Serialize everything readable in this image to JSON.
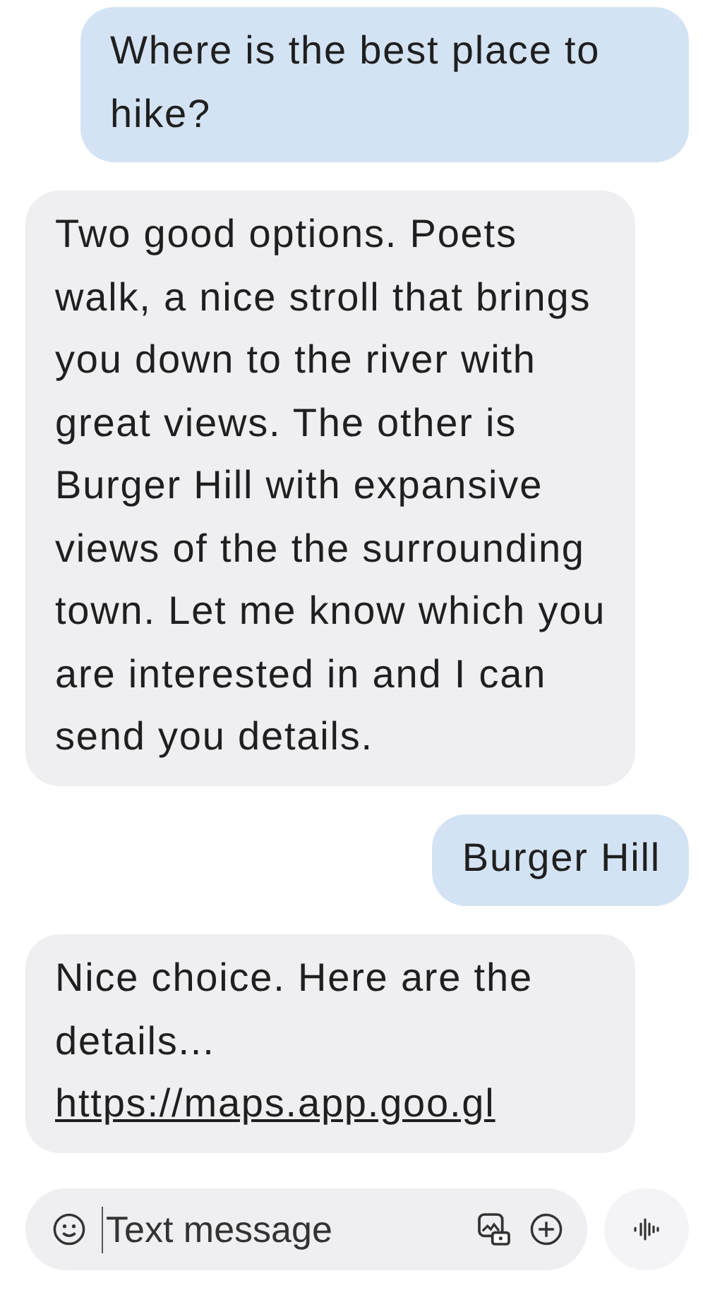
{
  "messages": [
    {
      "kind": "sent",
      "text": "Where is the best place to hike?"
    },
    {
      "kind": "received",
      "text": "Two good options. Poets walk, a nice stroll that brings you down to the river with great views. The other is Burger Hill with expansive views of the the surrounding town. Let me know which you are interested in and I can send you details."
    },
    {
      "kind": "sent",
      "text": "Burger Hill"
    },
    {
      "kind": "received",
      "text": "Nice choice. Here are the details...",
      "link": "https://maps.app.goo.gl"
    }
  ],
  "composer": {
    "placeholder": "Text message"
  }
}
